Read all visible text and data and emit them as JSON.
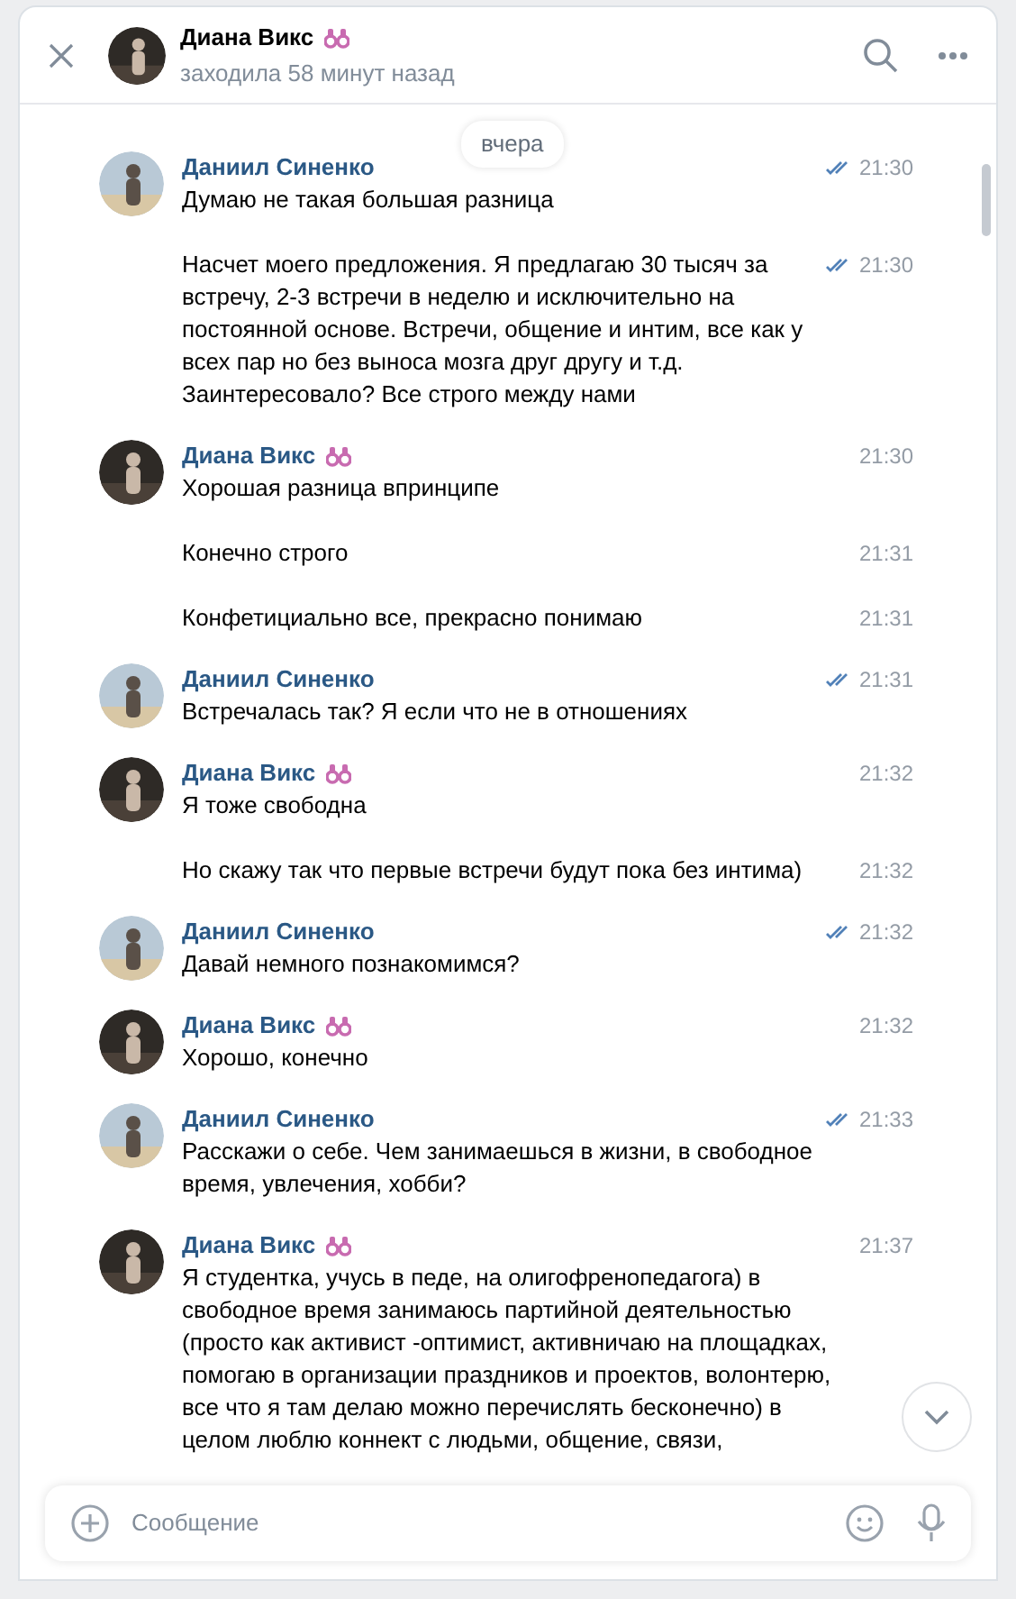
{
  "header": {
    "name": "Диана Викс",
    "status": "заходила 58 минут назад"
  },
  "date_pill": "вчера",
  "messages": [
    {
      "author": "Даниил Синенко",
      "kind": "outgoing",
      "badge": false,
      "items": [
        {
          "text": "Думаю не такая большая разница",
          "time": "21:30",
          "read": true
        },
        {
          "text": "Насчет моего предложения. Я предлагаю 30 тысяч за встречу, 2-3 встречи в неделю и исключительно на постоянной основе. Встречи, общение и интим, все как у всех пар но без выноса мозга друг другу и т.д. Заинтересовало? Все строго между нами",
          "time": "21:30",
          "read": true
        }
      ]
    },
    {
      "author": "Диана Викс",
      "kind": "incoming",
      "badge": true,
      "items": [
        {
          "text": "Хорошая разница впринципе",
          "time": "21:30",
          "read": false
        },
        {
          "text": "Конечно строго",
          "time": "21:31",
          "read": false
        },
        {
          "text": "Конфетициально все, прекрасно понимаю",
          "time": "21:31",
          "read": false
        }
      ]
    },
    {
      "author": "Даниил Синенко",
      "kind": "outgoing",
      "badge": false,
      "items": [
        {
          "text": "Встречалась так? Я если что не в отношениях",
          "time": "21:31",
          "read": true
        }
      ]
    },
    {
      "author": "Диана Викс",
      "kind": "incoming",
      "badge": true,
      "items": [
        {
          "text": "Я тоже свободна",
          "time": "21:32",
          "read": false
        },
        {
          "text": "Но скажу так что первые встречи будут пока без интима)",
          "time": "21:32",
          "read": false
        }
      ]
    },
    {
      "author": "Даниил Синенко",
      "kind": "outgoing",
      "badge": false,
      "items": [
        {
          "text": "Давай немного познакомимся?",
          "time": "21:32",
          "read": true
        }
      ]
    },
    {
      "author": "Диана Викс",
      "kind": "incoming",
      "badge": true,
      "items": [
        {
          "text": "Хорошо, конечно",
          "time": "21:32",
          "read": false
        }
      ]
    },
    {
      "author": "Даниил Синенко",
      "kind": "outgoing",
      "badge": false,
      "items": [
        {
          "text": "Расскажи о себе. Чем занимаешься в жизни, в свободное время, увлечения, хобби?",
          "time": "21:33",
          "read": true
        }
      ]
    },
    {
      "author": "Диана Викс",
      "kind": "incoming",
      "badge": true,
      "items": [
        {
          "text": "Я студентка, учусь в педе, на олигофренопедагога) в свободное время занимаюсь партийной деятельностью (просто как активист -оптимист, активничаю на площадках, помогаю в организации праздников и проектов, волонтерю, все что я там делаю можно перечислять бесконечно) в целом люблю коннект с людьми, общение, связи,",
          "time": "21:37",
          "read": false
        }
      ]
    }
  ],
  "composer": {
    "placeholder": "Сообщение"
  }
}
